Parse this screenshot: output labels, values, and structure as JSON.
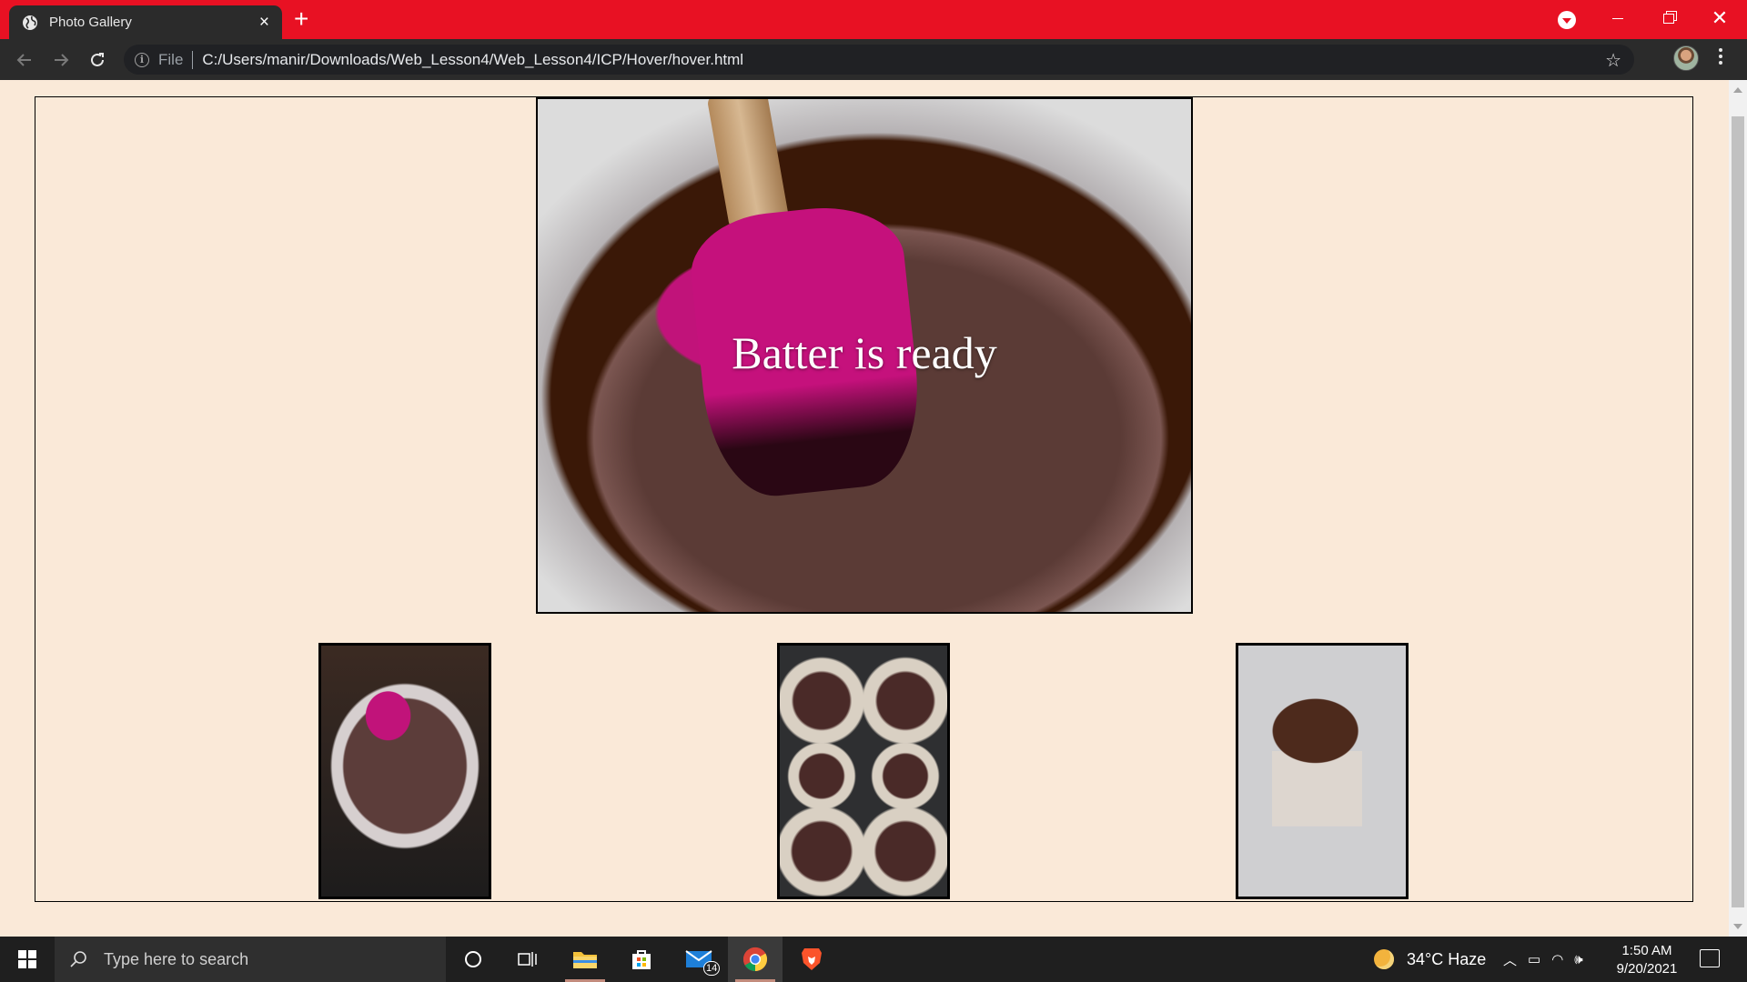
{
  "browser": {
    "tab_title": "Photo Gallery",
    "tab_close": "×",
    "new_tab": "+",
    "address_scheme": "File",
    "address_url": "C:/Users/manir/Downloads/Web_Lesson4/Web_Lesson4/ICP/Hover/hover.html",
    "accent_color": "#e81123"
  },
  "gallery": {
    "hero_caption": "Batter is ready",
    "background_color": "#fae9d8",
    "thumbnails": [
      {
        "subject": "chocolate batter in bowl with pink spatula"
      },
      {
        "subject": "cupcake liners filled with batter in tin"
      },
      {
        "subject": "frosted chocolate cupcake"
      }
    ]
  },
  "taskbar": {
    "search_placeholder": "Type here to search",
    "mail_badge": "14",
    "weather": "34°C  Haze",
    "time": "1:50 AM",
    "date": "9/20/2021"
  }
}
